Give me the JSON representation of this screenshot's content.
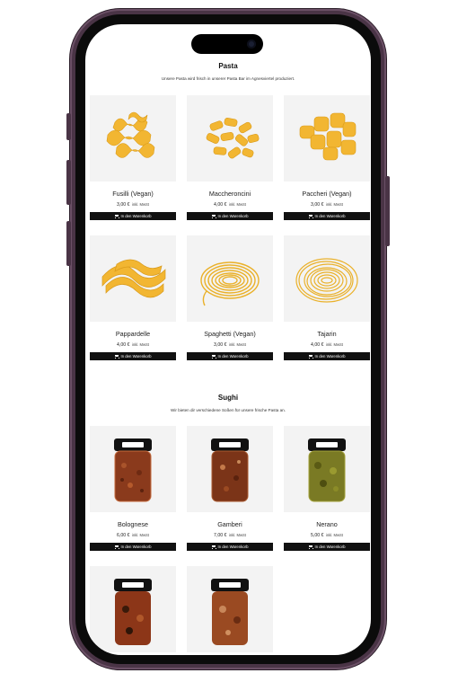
{
  "pasta_section": {
    "title": "Pasta",
    "subtitle": "Unsere Pasta wird frisch in unserer Pasta Bar im Agnesviertel produziert."
  },
  "sughi_section": {
    "title": "Sughi",
    "subtitle": "Wir bieten dir verschiedene Soßen für unsere frische Pasta an."
  },
  "cart_button_label": "In den Warenkorb",
  "vat_label": "inkl. MwSt",
  "pasta_products": [
    {
      "name": "Fusilli (Vegan)",
      "price": "3,00 €",
      "image": "fusilli-image"
    },
    {
      "name": "Maccheroncini",
      "price": "4,00 €",
      "image": "maccheroncini-image"
    },
    {
      "name": "Paccheri (Vegan)",
      "price": "3,00 €",
      "image": "paccheri-image"
    },
    {
      "name": "Pappardelle",
      "price": "4,00 €",
      "image": "pappardelle-image"
    },
    {
      "name": "Spaghetti (Vegan)",
      "price": "3,00 €",
      "image": "spaghetti-image"
    },
    {
      "name": "Tajarin",
      "price": "4,00 €",
      "image": "tajarin-image"
    }
  ],
  "sughi_products": [
    {
      "name": "Bolognese",
      "price": "6,00 €",
      "image": "bolognese-jar-image"
    },
    {
      "name": "Gamberi",
      "price": "7,00 €",
      "image": "gamberi-jar-image"
    },
    {
      "name": "Nerano",
      "price": "5,00 €",
      "image": "nerano-jar-image"
    },
    {
      "name": "",
      "price": "",
      "image": "sauce-jar-image"
    },
    {
      "name": "",
      "price": "",
      "image": "sauce-jar-image"
    }
  ],
  "colors": {
    "phone_frame": "#4a3446",
    "pasta_yellow": "#f2b632",
    "button_bg": "#111111",
    "image_bg": "#f3f3f3"
  }
}
